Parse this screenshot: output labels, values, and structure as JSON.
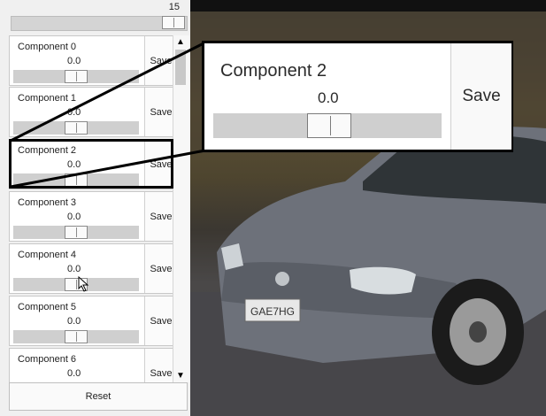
{
  "controls": {
    "top_value": "15",
    "components": [
      {
        "name": "Component 0",
        "value": "0.0",
        "save": "Save"
      },
      {
        "name": "Component 1",
        "value": "0.0",
        "save": "Save"
      },
      {
        "name": "Component 2",
        "value": "0.0",
        "save": "Save"
      },
      {
        "name": "Component 3",
        "value": "0.0",
        "save": "Save"
      },
      {
        "name": "Component 4",
        "value": "0.0",
        "save": "Save"
      },
      {
        "name": "Component 5",
        "value": "0.0",
        "save": "Save"
      },
      {
        "name": "Component 6",
        "value": "0.0",
        "save": "Save"
      }
    ],
    "reset_label": "Reset"
  },
  "callout": {
    "name": "Component 2",
    "value": "0.0",
    "save": "Save"
  },
  "photo": {
    "plate_text": "GAE7HG"
  },
  "icons": {
    "scroll_up": "chevron-up-icon",
    "scroll_down": "chevron-down-icon"
  },
  "colors": {
    "highlight_border": "#000000",
    "car_body": "#6d717a"
  }
}
